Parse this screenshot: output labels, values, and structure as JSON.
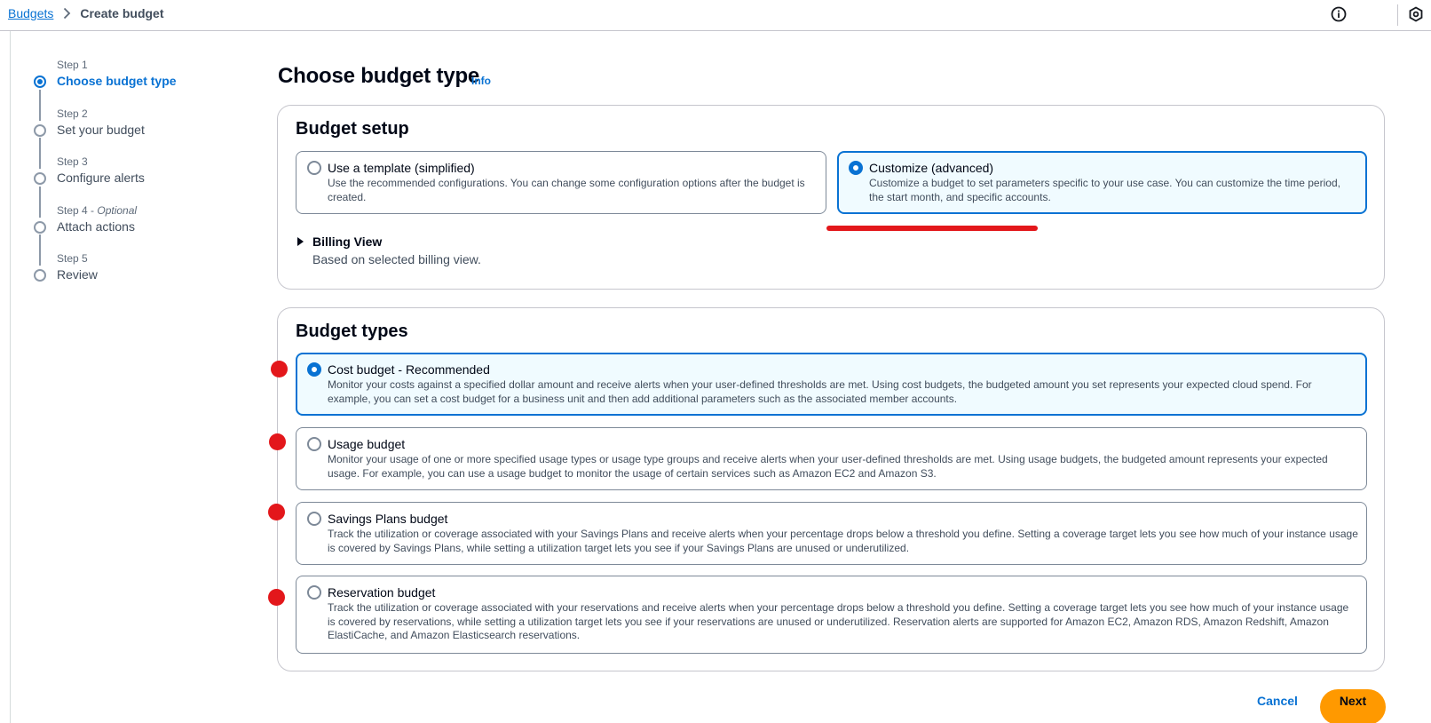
{
  "breadcrumb": {
    "root": "Budgets",
    "current": "Create budget"
  },
  "header_icons": [
    "info-circle-icon",
    "settings-hexagon-icon"
  ],
  "steps": [
    {
      "number": "Step 1",
      "title": "Choose budget type",
      "active": true
    },
    {
      "number": "Step 2",
      "title": "Set your budget",
      "active": false
    },
    {
      "number": "Step 3",
      "title": "Configure alerts",
      "active": false
    },
    {
      "number": "Step 4",
      "optional": "Optional",
      "title": "Attach actions",
      "active": false
    },
    {
      "number": "Step 5",
      "title": "Review",
      "active": false
    }
  ],
  "page": {
    "title": "Choose budget type",
    "info_link": "Info"
  },
  "budget_setup": {
    "title": "Budget setup",
    "options": [
      {
        "label": "Use a template (simplified)",
        "description": "Use the recommended configurations. You can change some configuration options after the budget is created.",
        "selected": false
      },
      {
        "label": "Customize (advanced)",
        "description": "Customize a budget to set parameters specific to your use case. You can customize the time period, the start month, and specific accounts.",
        "selected": true
      }
    ],
    "billing_view": {
      "label": "Billing View",
      "description": "Based on selected billing view."
    }
  },
  "budget_types": {
    "title": "Budget types",
    "options": [
      {
        "label": "Cost budget - Recommended",
        "description": "Monitor your costs against a specified dollar amount and receive alerts when your user-defined thresholds are met. Using cost budgets, the budgeted amount you set represents your expected cloud spend. For example, you can set a cost budget for a business unit and then add additional parameters such as the associated member accounts.",
        "selected": true
      },
      {
        "label": "Usage budget",
        "description": "Monitor your usage of one or more specified usage types or usage type groups and receive alerts when your user-defined thresholds are met. Using usage budgets, the budgeted amount represents your expected usage. For example, you can use a usage budget to monitor the usage of certain services such as Amazon EC2 and Amazon S3.",
        "selected": false
      },
      {
        "label": "Savings Plans budget",
        "description": "Track the utilization or coverage associated with your Savings Plans and receive alerts when your percentage drops below a threshold you define. Setting a coverage target lets you see how much of your instance usage is covered by Savings Plans, while setting a utilization target lets you see if your Savings Plans are unused or underutilized.",
        "selected": false
      },
      {
        "label": "Reservation budget",
        "description": "Track the utilization or coverage associated with your reservations and receive alerts when your percentage drops below a threshold you define. Setting a coverage target lets you see how much of your instance usage is covered by reservations, while setting a utilization target lets you see if your reservations are unused or underutilized. Reservation alerts are supported for Amazon EC2, Amazon RDS, Amazon Redshift, Amazon ElastiCache, and Amazon Elasticsearch reservations.",
        "selected": false
      }
    ]
  },
  "footer": {
    "cancel_label": "Cancel",
    "next_label": "Next"
  },
  "colors": {
    "accent": "#0972d3",
    "primary_button": "#ff9900",
    "annotation": "#e3171b",
    "selected_tile_bg": "#f0fbff"
  }
}
